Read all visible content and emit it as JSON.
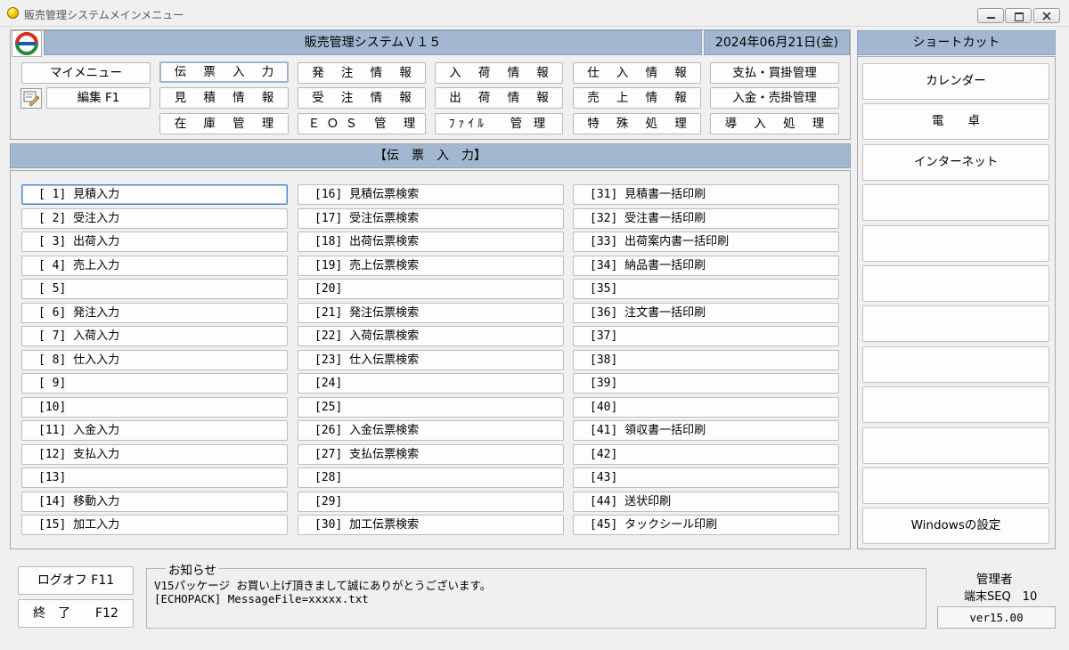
{
  "window": {
    "title": "販売管理システムメインメニュー"
  },
  "header": {
    "system_name": "販売管理システムＶ１５",
    "date": "2024年06月21日(金)"
  },
  "menu": {
    "my_menu": "マイメニュー",
    "edit": "編集 F1",
    "grid": [
      [
        "伝 票 入 力",
        "発 注 情 報",
        "入 荷 情 報",
        "仕 入 情 報",
        "支払・買掛管理"
      ],
      [
        "見 積 情 報",
        "受 注 情 報",
        "出 荷 情 報",
        "売 上 情 報",
        "入金・売掛管理"
      ],
      [
        "在 庫 管 理",
        "ＥＯＳ 管 理",
        "ﾌｧｲﾙ　 管 理",
        "特 殊 処 理",
        "導 入 処 理"
      ]
    ],
    "selected": "伝 票 入 力"
  },
  "section": {
    "title": "【伝　票　入　力】"
  },
  "items": {
    "col1": [
      "[ 1] 見積入力",
      "[ 2] 受注入力",
      "[ 3] 出荷入力",
      "[ 4] 売上入力",
      "[ 5]",
      "[ 6] 発注入力",
      "[ 7] 入荷入力",
      "[ 8] 仕入入力",
      "[ 9]",
      "[10]",
      "[11] 入金入力",
      "[12] 支払入力",
      "[13]",
      "[14] 移動入力",
      "[15] 加工入力"
    ],
    "col2": [
      "[16] 見積伝票検索",
      "[17] 受注伝票検索",
      "[18] 出荷伝票検索",
      "[19] 売上伝票検索",
      "[20]",
      "[21] 発注伝票検索",
      "[22] 入荷伝票検索",
      "[23] 仕入伝票検索",
      "[24]",
      "[25]",
      "[26] 入金伝票検索",
      "[27] 支払伝票検索",
      "[28]",
      "[29]",
      "[30] 加工伝票検索"
    ],
    "col3": [
      "[31] 見積書一括印刷",
      "[32] 受注書一括印刷",
      "[33] 出荷案内書一括印刷",
      "[34] 納品書一括印刷",
      "[35]",
      "[36] 注文書一括印刷",
      "[37]",
      "[38]",
      "[39]",
      "[40]",
      "[41] 領収書一括印刷",
      "[42]",
      "[43]",
      "[44] 送状印刷",
      "[45] タックシール印刷"
    ]
  },
  "shortcut": {
    "title": "ショートカット",
    "buttons": [
      "カレンダー",
      "電　　卓",
      "インターネット",
      "",
      "",
      "",
      "",
      "",
      "",
      "",
      "",
      "Windowsの設定"
    ]
  },
  "footer": {
    "logoff": "ログオフ F11",
    "exit": "終　了　　F12",
    "notice_label": "お知らせ",
    "notice_lines": [
      "V15パッケージ お買い上げ頂きまして誠にありがとうございます。",
      "[ECHOPACK] MessageFile=xxxxx.txt"
    ],
    "user": "管理者",
    "terminal": "端末SEQ　10",
    "version": "ver15.00"
  },
  "colors": {
    "header_bar": "#a3b8d0",
    "selected_border": "#4a86c8"
  }
}
